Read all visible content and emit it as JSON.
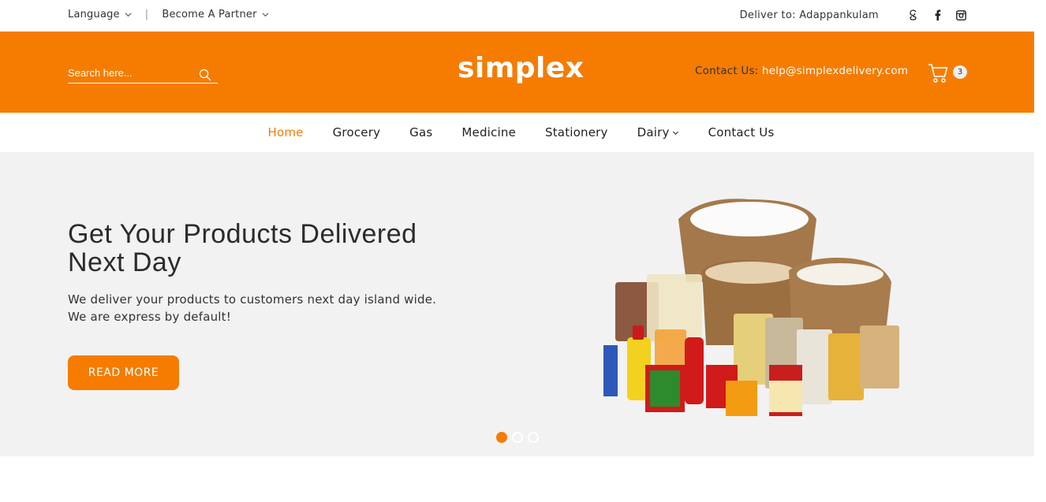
{
  "topbar": {
    "language": "Language",
    "partner": "Become A Partner",
    "separator": "|",
    "deliver_label": "Deliver to: Adappankulam",
    "social": [
      "google-icon",
      "facebook-icon",
      "instagram-icon"
    ]
  },
  "header": {
    "search_placeholder": "Search here...",
    "logo": "simplex",
    "contact_label": "Contact Us:",
    "contact_email": "help@simplexdelivery.com",
    "cart_count": "3"
  },
  "nav": {
    "items": [
      {
        "label": "Home"
      },
      {
        "label": "Grocery"
      },
      {
        "label": "Gas"
      },
      {
        "label": "Medicine"
      },
      {
        "label": "Stationery"
      },
      {
        "label": "Dairy"
      },
      {
        "label": "Contact Us"
      }
    ]
  },
  "hero": {
    "title": "Get Your Products Delivered Next Day",
    "text": "We deliver your products to customers next day island wide. We are express by default!",
    "button": "READ MORE",
    "slide_count": 3,
    "active_slide": 1
  },
  "colors": {
    "brand": "#f57c00",
    "hero_bg": "#f2f2f2"
  }
}
